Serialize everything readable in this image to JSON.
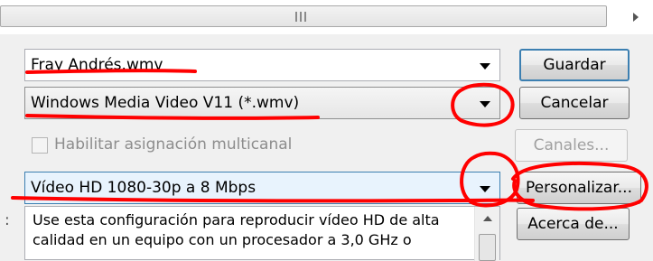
{
  "file_name": {
    "value": "Fray Andrés.wmv"
  },
  "file_type": {
    "value": "Windows Media Video V11 (*.wmv)"
  },
  "multichannel": {
    "label": "Habilitar asignación multicanal",
    "checked": false,
    "enabled": false
  },
  "profile": {
    "value": "Vídeo HD 1080-30p a 8 Mbps"
  },
  "description": {
    "line1": "Use esta configuración para reproducir vídeo HD de alta",
    "line2": "calidad en un equipo con un procesador a 3,0 GHz o"
  },
  "buttons": {
    "save": "Guardar",
    "cancel": "Cancelar",
    "channels": "Canales...",
    "customize": "Personalizar...",
    "about": "Acerca de..."
  },
  "annotation_color": "#ff0000"
}
